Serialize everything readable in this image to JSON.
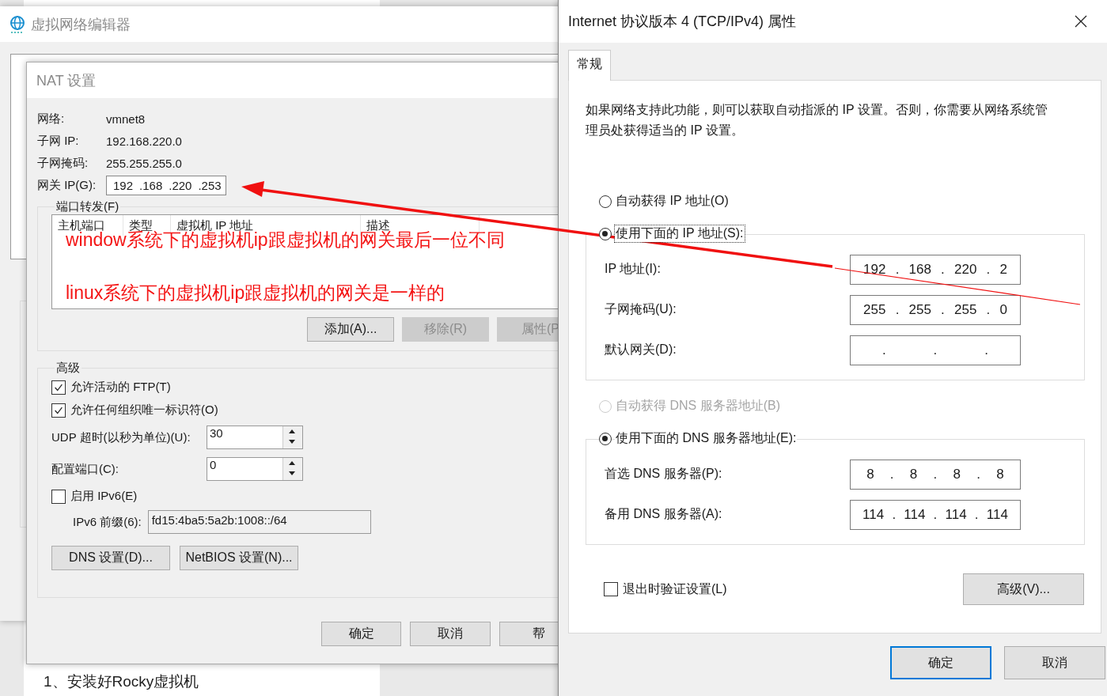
{
  "background_page": {
    "footer_text": "1、安装好Rocky虚拟机"
  },
  "editor_window": {
    "title": "虚拟网络编辑器"
  },
  "nat_window": {
    "title": "NAT 设置",
    "info": [
      {
        "label": "网络:",
        "value": "vmnet8"
      },
      {
        "label": "子网 IP:",
        "value": "192.168.220.0"
      },
      {
        "label": "子网掩码:",
        "value": "255.255.255.0"
      }
    ],
    "gateway": {
      "label": "网关 IP(G):",
      "parts": [
        "192",
        ".168",
        ".220",
        ".253"
      ]
    },
    "port_forwarding": {
      "title": "端口转发(F)",
      "columns": [
        "主机端口",
        "类型",
        "虚拟机 IP 地址",
        "描述"
      ],
      "buttons": [
        {
          "label": "添加(A)...",
          "disabled": false
        },
        {
          "label": "移除(R)",
          "disabled": true
        },
        {
          "label": "属性(P",
          "disabled": true
        }
      ]
    },
    "advanced": {
      "title": "高级",
      "checkboxes": [
        {
          "label": "允许活动的 FTP(T)",
          "checked": true
        },
        {
          "label": "允许任何组织唯一标识符(O)",
          "checked": true
        }
      ],
      "spinners": [
        {
          "label": "UDP 超时(以秒为单位)(U):",
          "value": "30"
        },
        {
          "label": "配置端口(C):",
          "value": "0"
        }
      ],
      "ipv6": {
        "label": "启用 IPv6(E)",
        "checked": false
      },
      "ipv6_prefix": {
        "label": "IPv6 前缀(6):",
        "value": "fd15:4ba5:5a2b:1008::/64"
      },
      "buttons": [
        "DNS 设置(D)...",
        "NetBIOS 设置(N)..."
      ]
    },
    "footer_buttons": [
      "确定",
      "取消",
      "帮"
    ]
  },
  "annotation": {
    "lines": [
      "window系统下的虚拟机ip跟虚拟机的网关最后一位不同",
      "linux系统下的虚拟机ip跟虚拟机的网关是一样的"
    ]
  },
  "ipv4_window": {
    "title": "Internet 协议版本 4 (TCP/IPv4) 属性",
    "tabs": [
      {
        "label": "常规",
        "selected": true
      }
    ],
    "description": "如果网络支持此功能，则可以获取自动指派的 IP 设置。否则，你需要从网络系统管理员处获得适当的 IP 设置。",
    "ip_radios": [
      {
        "label": "自动获得 IP 地址(O)",
        "selected": false,
        "disabled": false
      },
      {
        "label": "使用下面的 IP 地址(S):",
        "selected": true,
        "disabled": false
      }
    ],
    "ip_fields": [
      {
        "label": "IP 地址(I):",
        "parts": [
          "192",
          ".",
          "168",
          ".",
          "220",
          ".",
          "2"
        ]
      },
      {
        "label": "子网掩码(U):",
        "parts": [
          "255",
          ".",
          "255",
          ".",
          "255",
          ".",
          "0"
        ]
      },
      {
        "label": "默认网关(D):",
        "parts": [
          ".",
          ".",
          "."
        ]
      }
    ],
    "dns_radios": [
      {
        "label": "自动获得 DNS 服务器地址(B)",
        "selected": false,
        "disabled": true
      },
      {
        "label": "使用下面的 DNS 服务器地址(E):",
        "selected": true,
        "disabled": false
      }
    ],
    "dns_fields": [
      {
        "label": "首选 DNS 服务器(P):",
        "parts": [
          "8",
          ".",
          "8",
          ".",
          "8",
          ".",
          "8"
        ]
      },
      {
        "label": "备用 DNS 服务器(A):",
        "parts": [
          "114",
          ".",
          "114",
          ".",
          "114",
          ".",
          "114"
        ]
      }
    ],
    "validate_on_exit": {
      "label": "退出时验证设置(L)",
      "checked": false
    },
    "advanced_button": "高级(V)...",
    "footer_buttons": [
      {
        "label": "确定",
        "default": true
      },
      {
        "label": "取消",
        "default": false
      }
    ]
  }
}
